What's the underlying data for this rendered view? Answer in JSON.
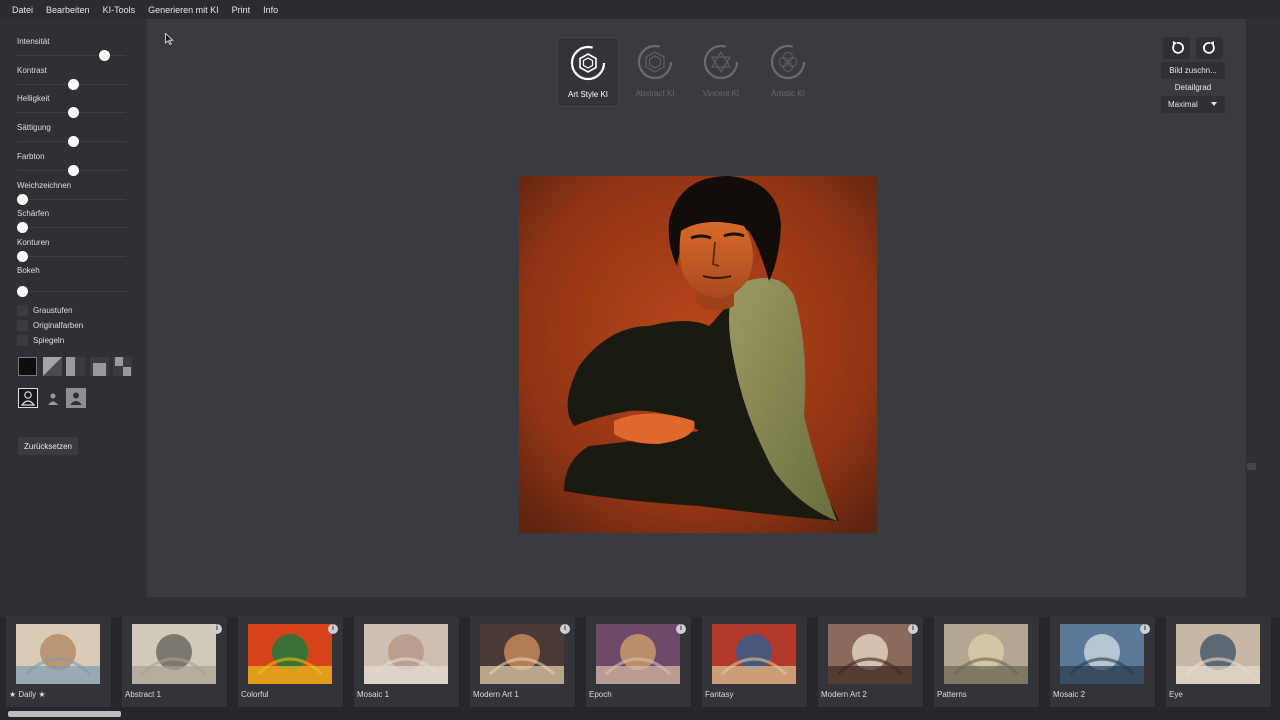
{
  "menu": [
    "Datei",
    "Bearbeiten",
    "KI-Tools",
    "Generieren mit KI",
    "Print",
    "Info"
  ],
  "sliders": [
    {
      "label": "Intensität",
      "value": 0.8
    },
    {
      "label": "Kontrast",
      "value": 0.5
    },
    {
      "label": "Helligkeit",
      "value": 0.5
    },
    {
      "label": "Sättigung",
      "value": 0.5
    },
    {
      "label": "Farbton",
      "value": 0.5
    },
    {
      "label": "Weichzeichnen",
      "value": 0
    },
    {
      "label": "Schärfen",
      "value": 0
    },
    {
      "label": "Konturen",
      "value": 0
    },
    {
      "label": "Bokeh",
      "value": 0
    }
  ],
  "checkboxes": [
    "Graustufen",
    "Originalfarben",
    "Spiegeln"
  ],
  "reset_label": "Zurücksetzen",
  "ai_modes": [
    {
      "label": "Art Style KI",
      "active": true
    },
    {
      "label": "Abstract KI",
      "active": false
    },
    {
      "label": "Vincent KI",
      "active": false
    },
    {
      "label": "Artistic KI",
      "active": false
    }
  ],
  "right_panel": {
    "crop_label": "Bild zuschn...",
    "detail_label": "Detailgrad",
    "detail_value": "Maximal"
  },
  "styles": [
    {
      "label": "★ Daily ★",
      "info": false
    },
    {
      "label": "Abstract 1",
      "info": true
    },
    {
      "label": "Colorful",
      "info": true
    },
    {
      "label": "Mosaic 1",
      "info": false
    },
    {
      "label": "Modern Art 1",
      "info": true
    },
    {
      "label": "Epoch",
      "info": true
    },
    {
      "label": "Fantasy",
      "info": false
    },
    {
      "label": "Modern Art 2",
      "info": true
    },
    {
      "label": "Patterns",
      "info": false
    },
    {
      "label": "Mosaic 2",
      "info": true
    },
    {
      "label": "Eye",
      "info": false
    }
  ],
  "colors": {
    "accent": "#ffffff",
    "panel": "#2f3036",
    "canvas": "#3a3b41"
  }
}
